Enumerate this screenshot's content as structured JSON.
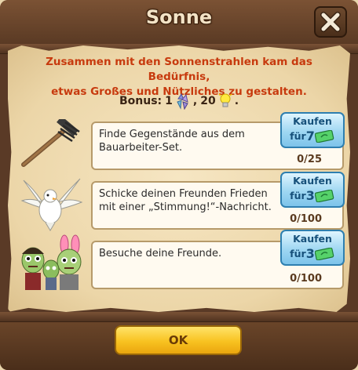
{
  "dialog": {
    "title": "Sonne",
    "intro_line1": "Zusammen mit den Sonnenstrahlen kam das Bedürfnis,",
    "intro_line2": "etwas Großes und Nützliches zu gestalten."
  },
  "bonus": {
    "label": "Bonus:",
    "amount1": "1",
    "separator": ",",
    "amount2": "20",
    "end": "."
  },
  "tasks": [
    {
      "icon": "rake-icon",
      "text": "Finde Gegenstände aus dem Bauarbeiter-Set.",
      "progress": "0/25",
      "buy_label": "Kaufen",
      "buy_price_prefix": "für",
      "buy_price": "7"
    },
    {
      "icon": "dove-icon",
      "text": "Schicke deinen Freunden Frieden mit einer „Stimmung!“-Nachricht.",
      "progress": "0/100",
      "buy_label": "Kaufen",
      "buy_price_prefix": "für",
      "buy_price": "3"
    },
    {
      "icon": "zombie-friends-icon",
      "text": "Besuche deine Freunde.",
      "progress": "0/100",
      "buy_label": "Kaufen",
      "buy_price_prefix": "für",
      "buy_price": "3"
    }
  ],
  "ok_label": "OK",
  "colors": {
    "intro_text": "#c73a0e",
    "buy_button": "#9fd7f2",
    "ok_button": "#f8c220"
  }
}
